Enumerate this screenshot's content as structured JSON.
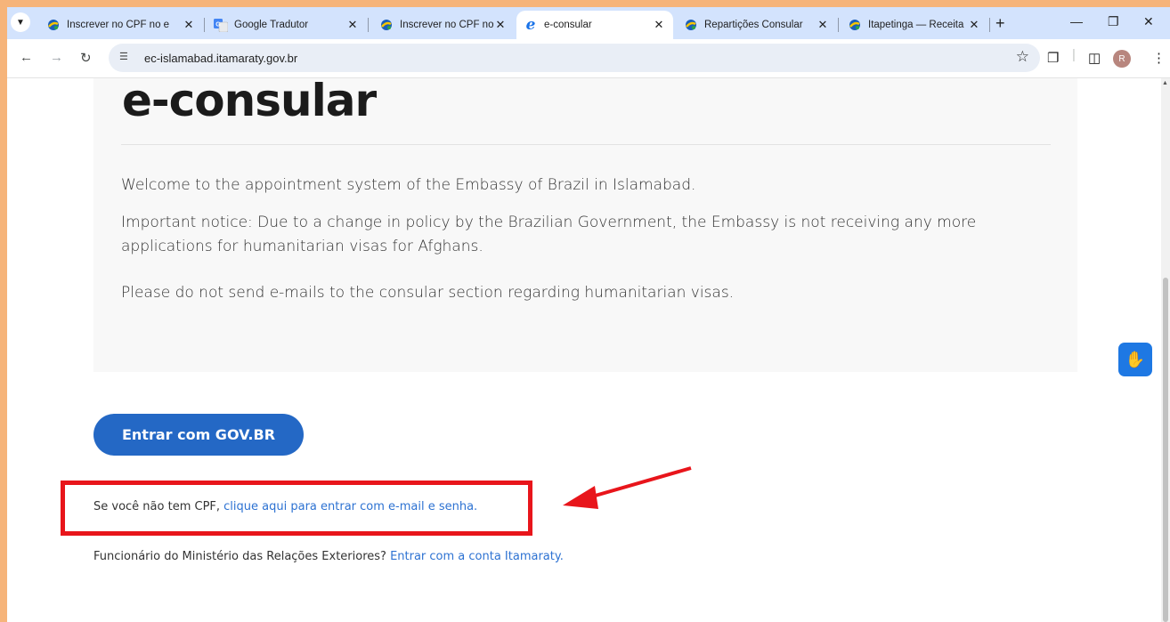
{
  "browser": {
    "tabs": [
      {
        "title": "Inscrever no CPF no e",
        "favicon": "gov-icon",
        "active": false
      },
      {
        "title": "Google Tradutor",
        "favicon": "translate-icon",
        "active": false
      },
      {
        "title": "Inscrever no CPF no e",
        "favicon": "gov-icon",
        "active": false
      },
      {
        "title": "e-consular",
        "favicon": "e-icon",
        "active": true
      },
      {
        "title": "Repartições Consular",
        "favicon": "gov-icon",
        "active": false
      },
      {
        "title": "Itapetinga — Receita",
        "favicon": "gov-icon",
        "active": false
      }
    ],
    "url": "ec-islamabad.itamaraty.gov.br",
    "profile_initial": "R"
  },
  "page": {
    "brand": "e-consular",
    "welcome": "Welcome to the appointment system of the Embassy of Brazil in Islamabad.",
    "notice": "Important notice: Due to a change in policy by the Brazilian Government, the Embassy is not receiving any more applications for humanitarian visas for Afghans.",
    "no_email": "Please do not send e-mails to the consular section regarding humanitarian visas.",
    "gov_button": "Entrar com GOV.BR",
    "no_cpf_prefix": "Se você não tem CPF, ",
    "no_cpf_link": "clique aqui para entrar com e-mail e senha.",
    "mre_prefix": "Funcionário do Ministério das Relações Exteriores? ",
    "mre_link": "Entrar com a conta Itamaraty."
  },
  "colors": {
    "annotation": "#e8151b",
    "accent": "#2468c5",
    "link": "#2d72d2",
    "border": "#f6b47a"
  }
}
